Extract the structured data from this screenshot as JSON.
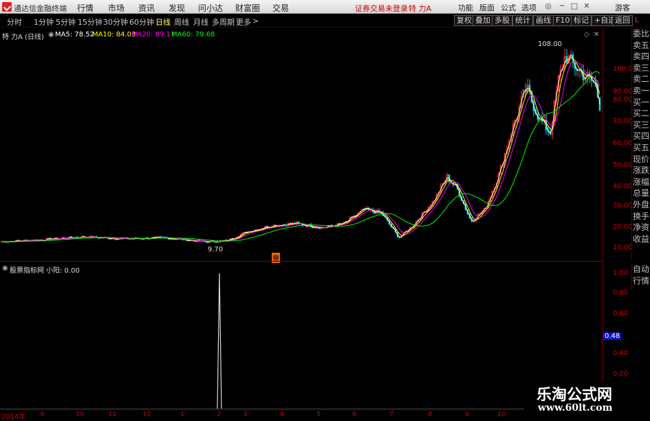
{
  "app": {
    "title": "通达信金融终端",
    "status": "证券交易未登录",
    "stock_title": "特 力A"
  },
  "menu": [
    "行情",
    "市场",
    "资讯",
    "发现",
    "问小达",
    "财富圈",
    "交易"
  ],
  "toolbar": [
    "功能",
    "版面",
    "公式",
    "选项"
  ],
  "guest": "游客",
  "periods": [
    "分时",
    "1分钟",
    "5分钟",
    "15分钟",
    "30分钟",
    "60分钟",
    "日线",
    "周线",
    "月线",
    "多周期",
    "更多"
  ],
  "right_buttons": [
    "复权",
    "叠加",
    "多股",
    "统计",
    "画线",
    "F10",
    "标记",
    "+自选",
    "返回"
  ],
  "main": {
    "stock": "特 力A",
    "period": "(日线)",
    "ma": [
      {
        "label": "MA5: 78.52",
        "color": "#ffffff"
      },
      {
        "label": "MA10: 84.03",
        "color": "#ffff00"
      },
      {
        "label": "MA20: 89.13",
        "color": "#ff00ff"
      },
      {
        "label": "MA60: 79.68",
        "color": "#00ff00"
      }
    ],
    "high_label": "108.00",
    "low_label": "9.70",
    "marker": "量"
  },
  "price_axis": [
    "100.00",
    "90.00",
    "80.00",
    "70.00",
    "60.00",
    "50.00",
    "40.00",
    "30.00",
    "20.00",
    "10.00"
  ],
  "side_panel": [
    "委比",
    "卖五",
    "卖四",
    "卖三",
    "卖二",
    "卖一",
    "买一",
    "买二",
    "买三",
    "买四",
    "买五",
    "现价",
    "涨跌",
    "涨幅",
    "总量",
    "外盘",
    "换手",
    "净资",
    "收益"
  ],
  "side_panel2": [
    "自动",
    "行情"
  ],
  "indicator": {
    "name": "股票指标网",
    "label": "小阳: 0.00",
    "axis": [
      "1.00",
      "0.80",
      "0.60",
      "0.48",
      "0.40",
      "0.20"
    ]
  },
  "date_axis": [
    "2014年",
    "9",
    "10",
    "11",
    "12",
    "1",
    "2",
    "3",
    "4",
    "5",
    "6",
    "7",
    "8",
    "9",
    "10"
  ],
  "watermark": {
    "title": "乐淘公式网",
    "url": "www.60lt.com"
  }
}
